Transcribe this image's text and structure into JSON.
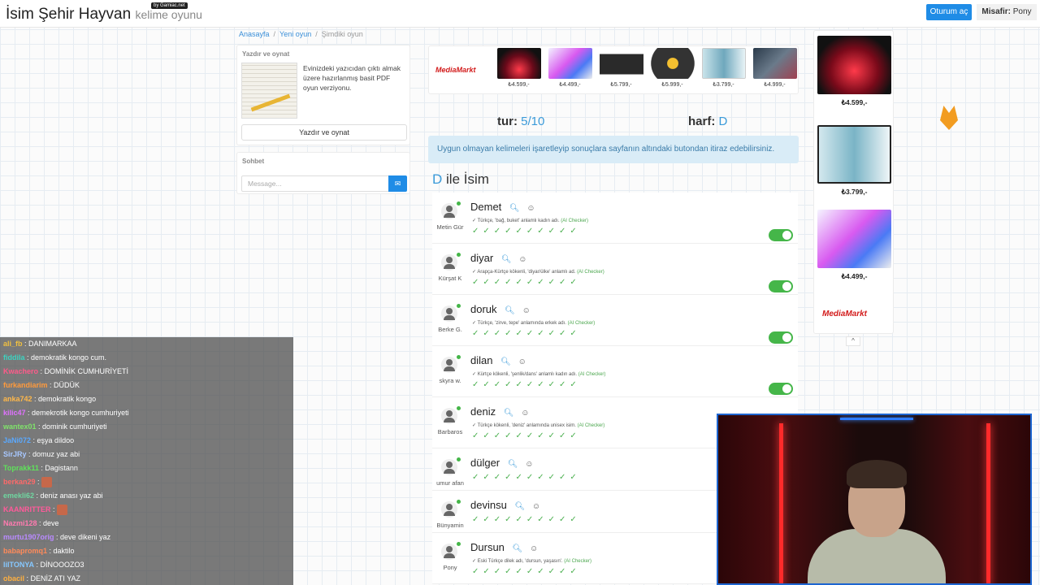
{
  "header": {
    "logo_main": "İsim Şehir Hayvan",
    "logo_sub": "kelime oyunu",
    "badge": "by Gamiac.net",
    "login_label": "Oturum aç",
    "user_prefix": "Misafir:",
    "user_name": "Pony"
  },
  "breadcrumb": [
    "Anasayfa",
    "/",
    "Yeni oyun",
    "/",
    "Şimdiki oyun"
  ],
  "print_card": {
    "title": "Yazdır ve oynat",
    "text": "Evinizdeki yazıcıdan çıktı almak üzere hazırlanmış basit PDF oyun verziyonu.",
    "button": "Yazdır ve oynat"
  },
  "chat_card": {
    "title": "Sohbet",
    "placeholder": "Message..."
  },
  "ad_top": {
    "logo": "MediaMarkt",
    "prices": [
      "₺4.599,-",
      "₺4.499,-",
      "₺5.799,-",
      "₺5.999,-",
      "₺3.799,-",
      "₺4.999,-"
    ]
  },
  "round": {
    "label": "tur:",
    "value": "5/10",
    "letter_label": "harf:",
    "letter": "D"
  },
  "alert": "Uygun olmayan kelimeleri işaretleyip sonuçlara sayfanın altındaki butondan itiraz edebilirsiniz.",
  "section": {
    "letter": "D",
    "title": "ile İsim"
  },
  "answers": [
    {
      "word": "Demet",
      "player": "Metin Gür",
      "desc": "Türkçe, 'bağ, buket' anlamlı kadın adı.",
      "ai": "(AI Checker)",
      "checks": "✓✓✓✓✓✓✓✓✓✓",
      "toggle": true
    },
    {
      "word": "diyar",
      "player": "Kürşat K",
      "desc": "Arapça-Kürtçe kökenli, 'diyar/ülke' anlamlı ad.",
      "ai": "(AI Checker)",
      "checks": "✓✓✓✓✓✓✓✓✓✓",
      "toggle": true
    },
    {
      "word": "doruk",
      "player": "Berke G.",
      "desc": "Türkçe, 'zirve, tepe' anlamında erkek adı.",
      "ai": "(AI Checker)",
      "checks": "✓✓✓✓✓✓✓✓✓✓",
      "toggle": true
    },
    {
      "word": "dilan",
      "player": "skyra w.",
      "desc": "Kürtçe kökenli, 'şenlik/dans' anlamlı kadın adı.",
      "ai": "(AI Checker)",
      "checks": "✓✓✓✓✓✓✓✓✓✓",
      "toggle": true
    },
    {
      "word": "deniz",
      "player": "Barbaros",
      "desc": "Türkçe kökenli, 'deniz' anlamında unisex isim.",
      "ai": "(AI Checker)",
      "checks": "✓✓✓✓✓✓✓✓✓✓",
      "toggle": false
    },
    {
      "word": "dülger",
      "player": "umur afan",
      "desc": "",
      "ai": "",
      "checks": "✓✓✓✓✓✓✓✓✓✓",
      "toggle": false
    },
    {
      "word": "devinsu",
      "player": "Bünyamin",
      "desc": "",
      "ai": "",
      "checks": "✓✓✓✓✓✓✓✓✓✓",
      "toggle": false
    },
    {
      "word": "Dursun",
      "player": "Pony",
      "desc": "Eski Türkçe dilek adı, 'dursun, yaşasın'.",
      "ai": "(AI Checker)",
      "checks": "✓✓✓✓✓✓✓✓✓✓",
      "toggle": false
    }
  ],
  "side_ad": {
    "prices": [
      "₺4.599,-",
      "₺3.799,-",
      "₺4.499,-"
    ],
    "logo": "MediaMarkt",
    "collapse": "^"
  },
  "chat_messages": [
    {
      "user": "ali_fb",
      "msg": ": DANIMARKAA",
      "color": "#f0c040"
    },
    {
      "user": "fiddila",
      "msg": ": demokratik kongo cum.",
      "color": "#3cd3c0"
    },
    {
      "user": "Kwachero",
      "msg": ": DOMİNİK CUMHURİYETİ",
      "color": "#ff5a8a"
    },
    {
      "user": "furkandiarim",
      "msg": ": DÜDÜK",
      "color": "#ff9a3c"
    },
    {
      "user": "anka742",
      "msg": ": demokratik kongo",
      "color": "#ffb84a"
    },
    {
      "user": "kilic47",
      "msg": ": demekrotik kongo cumhuriyeti",
      "color": "#e071ff"
    },
    {
      "user": "wantex01",
      "msg": ": dominik cumhuriyeti",
      "color": "#7fe36a"
    },
    {
      "user": "JaNi072",
      "msg": ": eşya dildoo",
      "color": "#5aa9ff"
    },
    {
      "user": "SirJRy",
      "msg": ": domuz yaz abi",
      "color": "#a8c8ff"
    },
    {
      "user": "Toprakk11",
      "msg": ": Dagistann",
      "color": "#5fe35a"
    },
    {
      "user": "berkan29",
      "msg": ":",
      "color": "#ff6a6a"
    },
    {
      "user": "emekli62",
      "msg": ": deniz anası yaz abi",
      "color": "#6fd6a0"
    },
    {
      "user": "KAANRITTER",
      "msg": ":",
      "color": "#ff5a9a"
    },
    {
      "user": "Nazmi128",
      "msg": ": deve",
      "color": "#ff7ab0"
    },
    {
      "user": "murtu1907orig",
      "msg": ": deve dikeni yaz",
      "color": "#b98aff"
    },
    {
      "user": "babapromq1",
      "msg": ": daktilo",
      "color": "#ff8a5a"
    },
    {
      "user": "lilTONYA",
      "msg": ": DİNOOOZO3",
      "color": "#86c8ff"
    },
    {
      "user": "obacil",
      "msg": ": DENİZ ATI YAZ",
      "color": "#ffb040"
    }
  ],
  "colors": {
    "accent": "#1f8ce6",
    "letter": "#3a9ad9",
    "check": "#4cb050",
    "alert_bg": "#d9ecf7"
  }
}
